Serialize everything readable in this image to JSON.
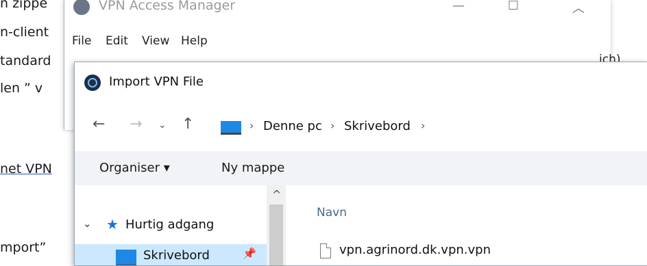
{
  "background_doc": {
    "lines": [
      "n zippe",
      "n-client",
      "tandard",
      "len ” v",
      "net VPN",
      "mport”"
    ],
    "right_fragment": "ich)"
  },
  "vpn_window": {
    "title": "VPN Access Manager",
    "menu": [
      "File",
      "Edit",
      "View",
      "Help"
    ]
  },
  "dialog": {
    "title": "Import VPN File",
    "breadcrumb": [
      "Denne pc",
      "Skrivebord"
    ],
    "toolbar": {
      "organise": "Organiser ▾",
      "new_folder": "Ny mappe"
    },
    "nav_pane": {
      "quick_access": "Hurtig adgang",
      "selected": "Skrivebord"
    },
    "file_list": {
      "column_name": "Navn",
      "files": [
        "vpn.agrinord.dk.vpn.vpn"
      ]
    }
  }
}
